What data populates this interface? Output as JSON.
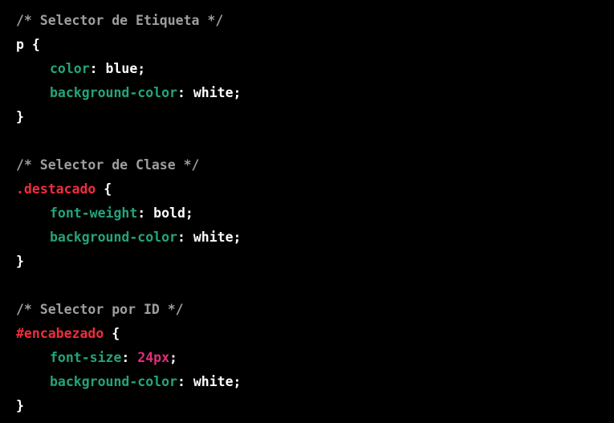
{
  "colors": {
    "background": "#000000",
    "comment": "#9e9e9e",
    "property": "#24a37c",
    "selector": "#f22c3d",
    "number": "#df3079",
    "text": "#ffffff"
  },
  "code": {
    "block1": {
      "comment": "/* Selector de Etiqueta */",
      "selector": "p",
      "open_brace": " {",
      "decl1_prop": "color",
      "decl1_value": "blue",
      "decl2_prop": "background-color",
      "decl2_value": "white",
      "close_brace": "}"
    },
    "block2": {
      "comment": "/* Selector de Clase */",
      "selector": ".destacado",
      "open_brace": " {",
      "decl1_prop": "font-weight",
      "decl1_value": "bold",
      "decl2_prop": "background-color",
      "decl2_value": "white",
      "close_brace": "}"
    },
    "block3": {
      "comment": "/* Selector por ID */",
      "selector": "#encabezado",
      "open_brace": " {",
      "decl1_prop": "font-size",
      "decl1_value": "24px",
      "decl2_prop": "background-color",
      "decl2_value": "white",
      "close_brace": "}"
    },
    "colon": ": ",
    "semicolon": ";"
  }
}
